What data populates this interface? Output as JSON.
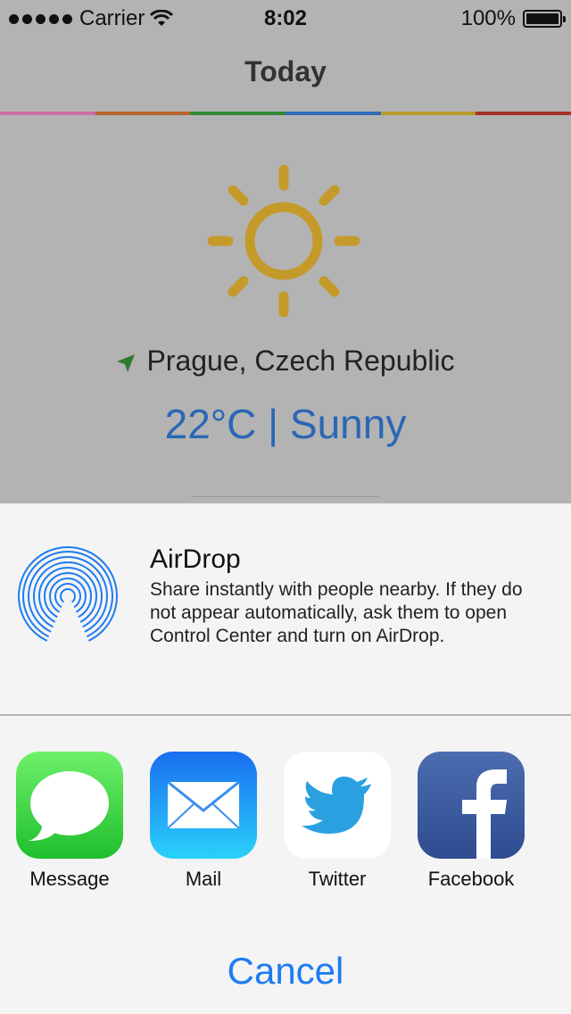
{
  "status_bar": {
    "carrier": "Carrier",
    "time": "8:02",
    "battery": "100%"
  },
  "nav": {
    "title": "Today"
  },
  "rainbow_colors": [
    "#c86fa3",
    "#b8652e",
    "#2f8a35",
    "#2c6db7",
    "#b99a2a",
    "#a33324"
  ],
  "weather": {
    "location": "Prague, Czech Republic",
    "temperature_condition": "22°C | Sunny",
    "sun_color": "#c49a2a",
    "temp_color": "#2a67b5",
    "location_icon": "location-arrow-icon"
  },
  "share_sheet": {
    "airdrop": {
      "title": "AirDrop",
      "description": "Share instantly with people nearby. If they do not appear automatically, ask them to open Control Center and turn on AirDrop.",
      "icon": "airdrop-icon"
    },
    "apps": [
      {
        "label": "Message",
        "icon": "message-icon"
      },
      {
        "label": "Mail",
        "icon": "mail-icon"
      },
      {
        "label": "Twitter",
        "icon": "twitter-icon"
      },
      {
        "label": "Facebook",
        "icon": "facebook-icon"
      }
    ],
    "cancel_label": "Cancel",
    "accent": "#1e7cf0"
  }
}
